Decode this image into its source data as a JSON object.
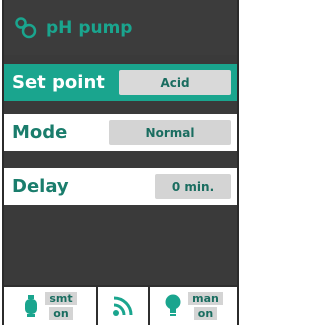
{
  "header": {
    "title": "pH pump",
    "icon": "pump-icon"
  },
  "rows": [
    {
      "label": "Set point",
      "value": "Acid"
    },
    {
      "label": "Mode",
      "value": "Normal"
    },
    {
      "label": "Delay",
      "value": "0 min."
    }
  ],
  "footer": {
    "pump_status": {
      "icon": "pump-status-icon",
      "line1": "smt",
      "line2": "on"
    },
    "signal": {
      "icon": "signal-icon"
    },
    "manual_status": {
      "icon": "light-bulb-icon",
      "line1": "man",
      "line2": "on"
    }
  },
  "colors": {
    "accent": "#1aa58e",
    "dark": "#3a3a3a",
    "pill": "#d4d4d4",
    "text": "#1a7d6c"
  }
}
